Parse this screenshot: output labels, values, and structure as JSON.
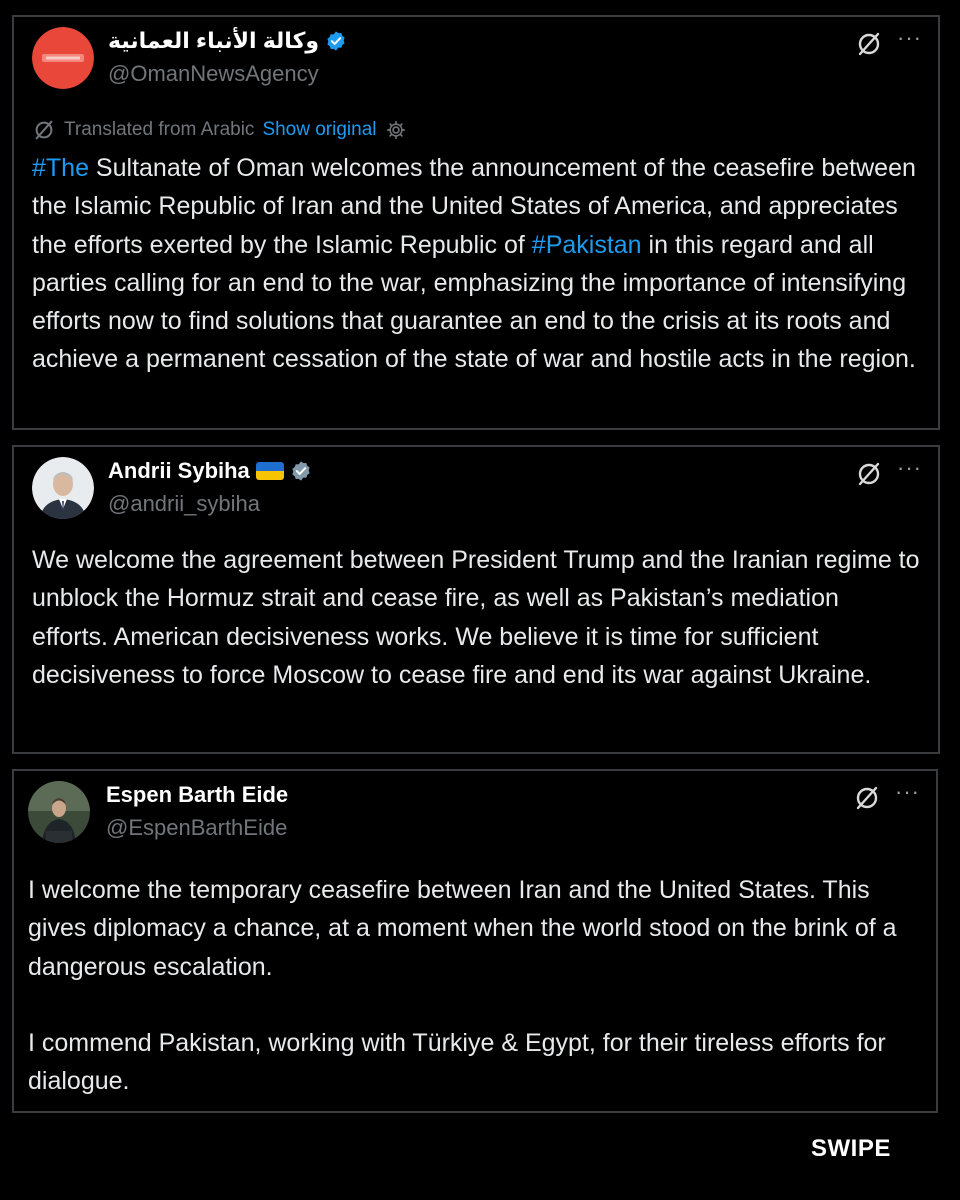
{
  "posts": [
    {
      "display_name": "وكالة الأنباء العمانية",
      "handle": "@OmanNewsAgency",
      "verified": true,
      "verified_color": "#1d9bf0",
      "translated_label": "Translated from Arabic",
      "show_original_label": "Show original",
      "text": {
        "hashtag_1": "#The",
        "part_1": " Sultanate of Oman welcomes the announcement of the ceasefire between the Islamic Republic of Iran and the United States of America, and appreciates the efforts exerted by the Islamic Republic of ",
        "hashtag_2": "#Pakistan",
        "part_2": " in this regard and all parties calling for an end to the war, emphasizing the importance of intensifying efforts now to find solutions that guarantee an end to the crisis at its roots and achieve a permanent cessation of the state of war and hostile acts in the region."
      }
    },
    {
      "display_name": "Andrii Sybiha",
      "handle": "@andrii_sybiha",
      "verified": true,
      "verified_color": "#829aab",
      "flag": "ukraine-flag",
      "text": "We welcome the agreement between President Trump and the Iranian regime to unblock the Hormuz strait and cease fire, as well as Pakistan’s mediation efforts. American decisiveness works. We believe it is time for sufficient decisiveness to force Moscow to cease fire and end its war against Ukraine."
    },
    {
      "display_name": "Espen Barth Eide",
      "handle": "@EspenBarthEide",
      "verified": false,
      "paragraphs": [
        "I welcome the temporary ceasefire between Iran and the United States. This gives diplomacy a chance, at a moment when the world stood on the  brink of a dangerous escalation.",
        "I commend Pakistan, working with Türkiye & Egypt, for their tireless efforts  for dialogue."
      ]
    }
  ],
  "more_icon_glyph": "···",
  "footer": {
    "swipe_label": "SWIPE"
  },
  "colors": {
    "background": "#000000",
    "card_border": "#3a3d40",
    "text": "#e7e9ea",
    "muted": "#71767b",
    "link": "#1d9bf0",
    "oman_avatar": "#e8473a"
  }
}
